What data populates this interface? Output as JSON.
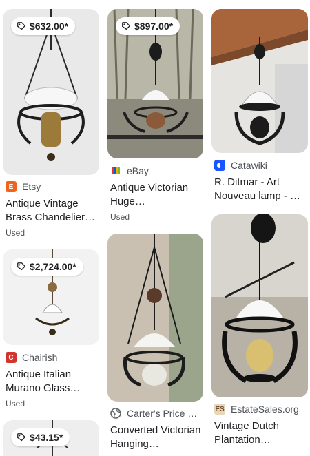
{
  "colors": {
    "etsy": "#f1641e",
    "chairish": "#d0342c",
    "catawiki": "#1a56ff",
    "price_bg": "#ffffff",
    "condition_text": "#4d5156"
  },
  "columns": [
    {
      "items": [
        {
          "price": "$632.00*",
          "source": "Etsy",
          "source_icon": "etsy-icon",
          "title": "Antique Vintage Brass Chandelier Hanging…",
          "condition": "Used"
        },
        {
          "price": "$2,724.00*",
          "source": "Chairish",
          "source_icon": "chairish-icon",
          "title": "Antique Italian Murano Glass and…",
          "condition": "Used"
        },
        {
          "price": "$43.15*"
        }
      ]
    },
    {
      "items": [
        {
          "price": "$897.00*",
          "source": "eBay",
          "source_icon": "ebay-icon",
          "title": "Antique Victorian Huge Bronze/Brass…",
          "condition": "Used"
        },
        {
          "source": "Carter's Price …",
          "source_icon": "globe-icon",
          "title": "Converted Victorian Hanging…"
        }
      ]
    },
    {
      "items": [
        {
          "source": "Catawiki",
          "source_icon": "catawiki-icon",
          "title": "R. Ditmar - Art Nouveau lamp - …"
        },
        {
          "source": "EstateSales.org",
          "source_icon": "estatesales-icon",
          "title": "Vintage Dutch Plantation Hanging…"
        }
      ]
    }
  ]
}
